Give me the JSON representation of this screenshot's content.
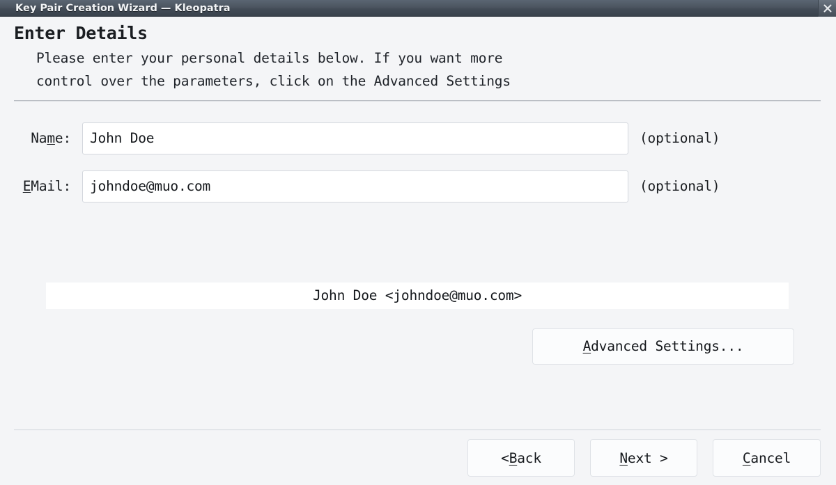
{
  "window": {
    "title": "Key Pair Creation Wizard — Kleopatra",
    "close_button_label": "Close",
    "close_icon": "close-x-icon"
  },
  "header": {
    "title": "Enter Details",
    "description": "Please enter your personal details below. If you want more\ncontrol over the parameters, click on the Advanced Settings"
  },
  "form": {
    "fields": [
      {
        "label_prefix": "Na",
        "label_mnemonic": "m",
        "label_suffix": "e:",
        "value": "John Doe",
        "placeholder": "",
        "note": "(optional)"
      },
      {
        "label_prefix": "",
        "label_mnemonic": "E",
        "label_suffix": "Mail:",
        "value": "johndoe@muo.com",
        "placeholder": "",
        "note": "(optional)"
      }
    ]
  },
  "preview": {
    "text": "John Doe <johndoe@muo.com>"
  },
  "advanced": {
    "prefix": "",
    "mnemonic": "A",
    "suffix": "dvanced Settings..."
  },
  "footer": {
    "back": {
      "prefix": "< ",
      "mnemonic": "B",
      "suffix": "ack"
    },
    "next": {
      "prefix": "",
      "mnemonic": "N",
      "suffix": "ext >"
    },
    "cancel": {
      "prefix": "",
      "mnemonic": "C",
      "suffix": "ancel"
    }
  },
  "colors": {
    "titlebar_start": "#5a6572",
    "titlebar_end": "#39424c",
    "titlebar_text": "#f2f4f6",
    "body_background": "#f4f5f7",
    "input_background": "#ffffff",
    "input_border": "#d3d7dd",
    "button_background": "#fbfcfd",
    "button_border": "#dfe2e7",
    "text_primary": "#15181c",
    "separator_top": "#b7bbc1",
    "separator_bottom": "#dcdfe4"
  }
}
